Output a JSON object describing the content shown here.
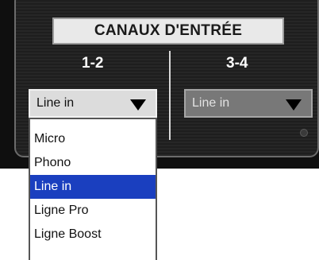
{
  "title": "CANAUX D'ENTRÉE",
  "channels": [
    {
      "label": "1-2",
      "selected": "Line in"
    },
    {
      "label": "3-4",
      "selected": "Line in"
    }
  ],
  "dropdown": {
    "options": [
      "Micro",
      "Phono",
      "Line in",
      "Ligne Pro",
      "Ligne Boost"
    ],
    "highlighted": "Line in"
  },
  "colors": {
    "highlight": "#1a3fbf",
    "panel_bg": "#0f0f0f"
  }
}
